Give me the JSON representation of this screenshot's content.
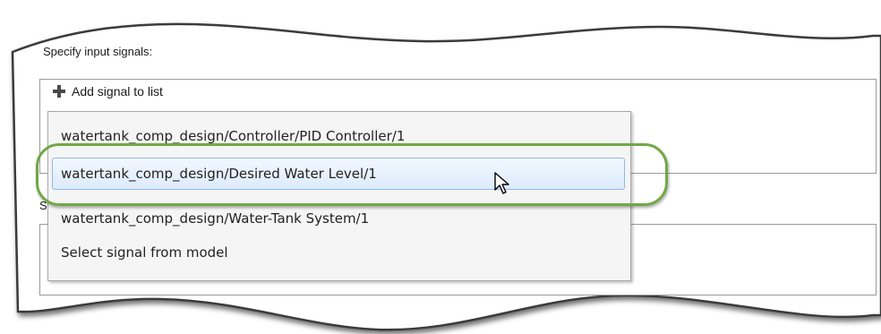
{
  "window": {
    "accent_color": "#71a847",
    "selection_color": "#dcebfc"
  },
  "input_signals": {
    "label": "Specify input signals:",
    "add_button_label": "Add signal to list",
    "add_icon": "plus-icon"
  },
  "dropdown": {
    "items": [
      {
        "label": "watertank_comp_design/Controller/PID Controller/1",
        "selected": false
      },
      {
        "label": "watertank_comp_design/Desired  Water Level/1",
        "selected": true
      },
      {
        "label": "watertank_comp_design/Water-Tank System/1",
        "selected": false
      },
      {
        "label": "Select signal from model",
        "selected": false
      }
    ]
  },
  "lower_section": {
    "label": "S"
  },
  "pointer": {
    "icon": "mouse-pointer-icon"
  }
}
